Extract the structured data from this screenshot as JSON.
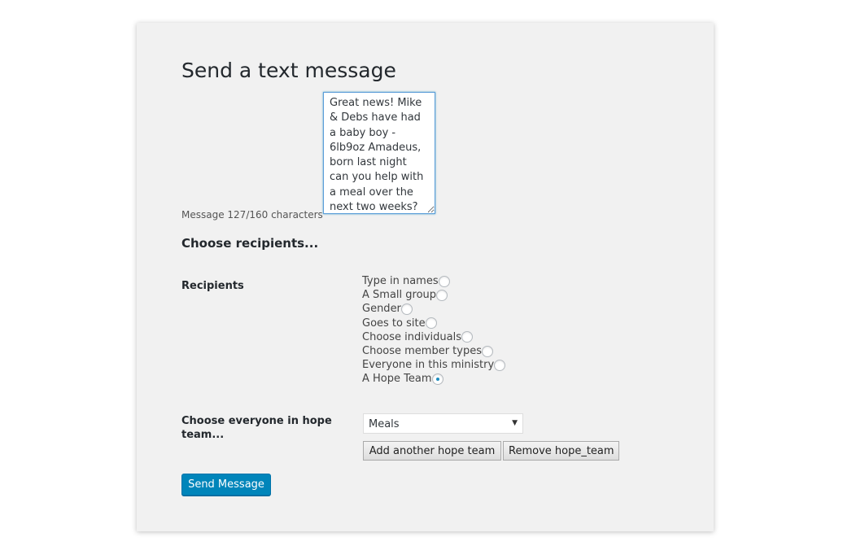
{
  "title": "Send a text message",
  "message": {
    "value": "Great news! Mike & Debs have had a baby boy - 6lb9oz Amadeus, born last night can you help with a meal over the next two weeks?",
    "counter": "Message 127/160 characters"
  },
  "recipients_heading": "Choose recipients...",
  "recipients_label": "Recipients",
  "options": [
    {
      "label": "Type in names",
      "checked": false
    },
    {
      "label": "A Small group",
      "checked": false
    },
    {
      "label": "Gender",
      "checked": false
    },
    {
      "label": "Goes to site",
      "checked": false
    },
    {
      "label": "Choose individuals",
      "checked": false
    },
    {
      "label": "Choose member types",
      "checked": false
    },
    {
      "label": "Everyone in this ministry",
      "checked": false
    },
    {
      "label": "A Hope Team",
      "checked": true
    }
  ],
  "hope_team": {
    "label": "Choose everyone in hope team...",
    "selected": "Meals",
    "add_label": "Add another hope team",
    "remove_label": "Remove hope_team"
  },
  "send_label": "Send Message",
  "colors": {
    "primary": "#0085ba",
    "panel": "#f1f1f1"
  }
}
